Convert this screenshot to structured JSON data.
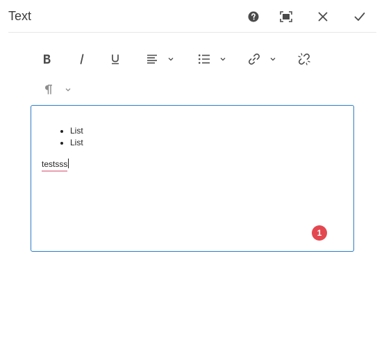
{
  "dialog": {
    "title": "Text"
  },
  "header_icons": [
    "help-icon",
    "fullscreen-icon",
    "close-icon",
    "check-icon"
  ],
  "toolbar_icons": [
    "bold-icon",
    "italic-icon",
    "underline-icon",
    "align-icon",
    "list-icon",
    "link-icon",
    "unlink-icon",
    "paragraph-icon"
  ],
  "editor": {
    "list_items": [
      "List",
      "List"
    ],
    "paragraph": "testsss"
  },
  "badge": {
    "count": "1"
  },
  "colors": {
    "accent": "#2b7cc4",
    "badge": "#e34850",
    "icon": "#4b4b4b",
    "icon_light": "#8e8e8e"
  }
}
